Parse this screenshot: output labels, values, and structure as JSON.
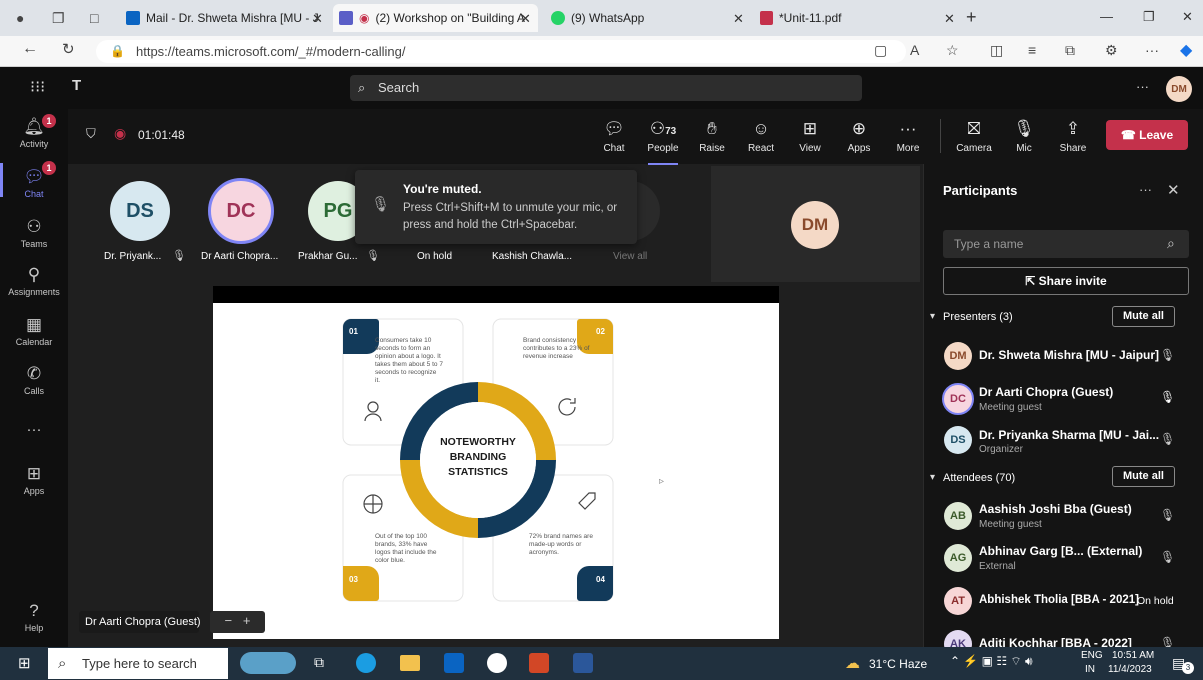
{
  "browser": {
    "tabs": [
      {
        "label": "Mail - Dr. Shweta Mishra [MU - J"
      },
      {
        "label": "(2) Workshop on \"Building A"
      },
      {
        "label": "(9) WhatsApp"
      },
      {
        "label": "*Unit-11.pdf"
      }
    ],
    "url": "https://teams.microsoft.com/_#/modern-calling/"
  },
  "teams": {
    "search_label": "Search",
    "user_initials": "DM",
    "rail": [
      {
        "label": "Activity",
        "badge": "1"
      },
      {
        "label": "Chat",
        "badge": "1"
      },
      {
        "label": "Teams"
      },
      {
        "label": "Assignments"
      },
      {
        "label": "Calendar"
      },
      {
        "label": "Calls"
      },
      {
        "label": "Apps"
      },
      {
        "label": "Help"
      }
    ]
  },
  "meeting": {
    "timer": "01:01:48",
    "people_count": "73",
    "controls": [
      "Chat",
      "People",
      "Raise",
      "React",
      "View",
      "Apps",
      "More",
      "Camera",
      "Mic",
      "Share"
    ],
    "leave_label": "Leave",
    "tiles": [
      {
        "initials": "DS",
        "name": "Dr. Priyank...",
        "color": "#d7e8f0"
      },
      {
        "initials": "DC",
        "name": "Dr Aarti Chopra...",
        "color": "#f7d6e0"
      },
      {
        "initials": "PG",
        "name": "Prakhar Gu...",
        "color": "#dff0e0"
      },
      {
        "initials": "",
        "name": "On hold"
      },
      {
        "initials": "",
        "name": "Kashish Chawla..."
      },
      {
        "initials": "",
        "name": "View all"
      }
    ],
    "muted_title": "You're muted.",
    "muted_body": "Press Ctrl+Shift+M to unmute your mic, or press and hold the Ctrl+Spacebar.",
    "dm_tile_initials": "DM",
    "presenter_label": "Dr Aarti Chopra (Guest)"
  },
  "slide": {
    "center_title": "NOTEWORTHY BRANDING STATISTICS",
    "cards": [
      {
        "num": "01",
        "text": "Consumers take 10 seconds to form an opinion about a logo. It takes them about 5 to 7 seconds to recognize it."
      },
      {
        "num": "02",
        "text": "Brand consistency contributes to a 23% of revenue increase"
      },
      {
        "num": "03",
        "text": "Out of the top 100 brands, 33% have logos that include the color blue."
      },
      {
        "num": "04",
        "text": "72% brand names are made-up words or acronyms."
      }
    ],
    "colors": {
      "navy": "#123a5a",
      "gold": "#e0a818",
      "teal": "#1a4d6e"
    }
  },
  "participants": {
    "title": "Participants",
    "search_placeholder": "Type a name",
    "share_invite": "Share invite",
    "presenters_label": "Presenters (3)",
    "attendees_label": "Attendees (70)",
    "mute_all": "Mute all",
    "presenters": [
      {
        "initials": "DM",
        "name": "Dr. Shweta Mishra [MU - Jaipur]",
        "sub": "",
        "color": "#f4d9c6"
      },
      {
        "initials": "DC",
        "name": "Dr Aarti Chopra (Guest)",
        "sub": "Meeting guest",
        "color": "#f7d6e0"
      },
      {
        "initials": "DS",
        "name": "Dr. Priyanka Sharma [MU - Jai...",
        "sub": "Organizer",
        "color": "#d7e8f0"
      }
    ],
    "attendees": [
      {
        "initials": "AB",
        "name": "Aashish Joshi Bba (Guest)",
        "sub": "Meeting guest",
        "color": "#dfe9d6"
      },
      {
        "initials": "AG",
        "name": "Abhinav Garg [B...  (External)",
        "sub": "External",
        "color": "#dfe9d6"
      },
      {
        "initials": "AT",
        "name": "Abhishek Tholia [BBA - 2021]",
        "sub": "",
        "status": "On hold",
        "color": "#f7d6d6"
      },
      {
        "initials": "AK",
        "name": "Aditi Kochhar [BBA - 2022]",
        "sub": "",
        "color": "#e3daf2"
      }
    ]
  },
  "taskbar": {
    "search_placeholder": "Type here to search",
    "weather": "31°C  Haze",
    "lang_top": "ENG",
    "lang_bottom": "IN",
    "time": "10:51 AM",
    "date": "11/4/2023",
    "notif_count": "3"
  }
}
